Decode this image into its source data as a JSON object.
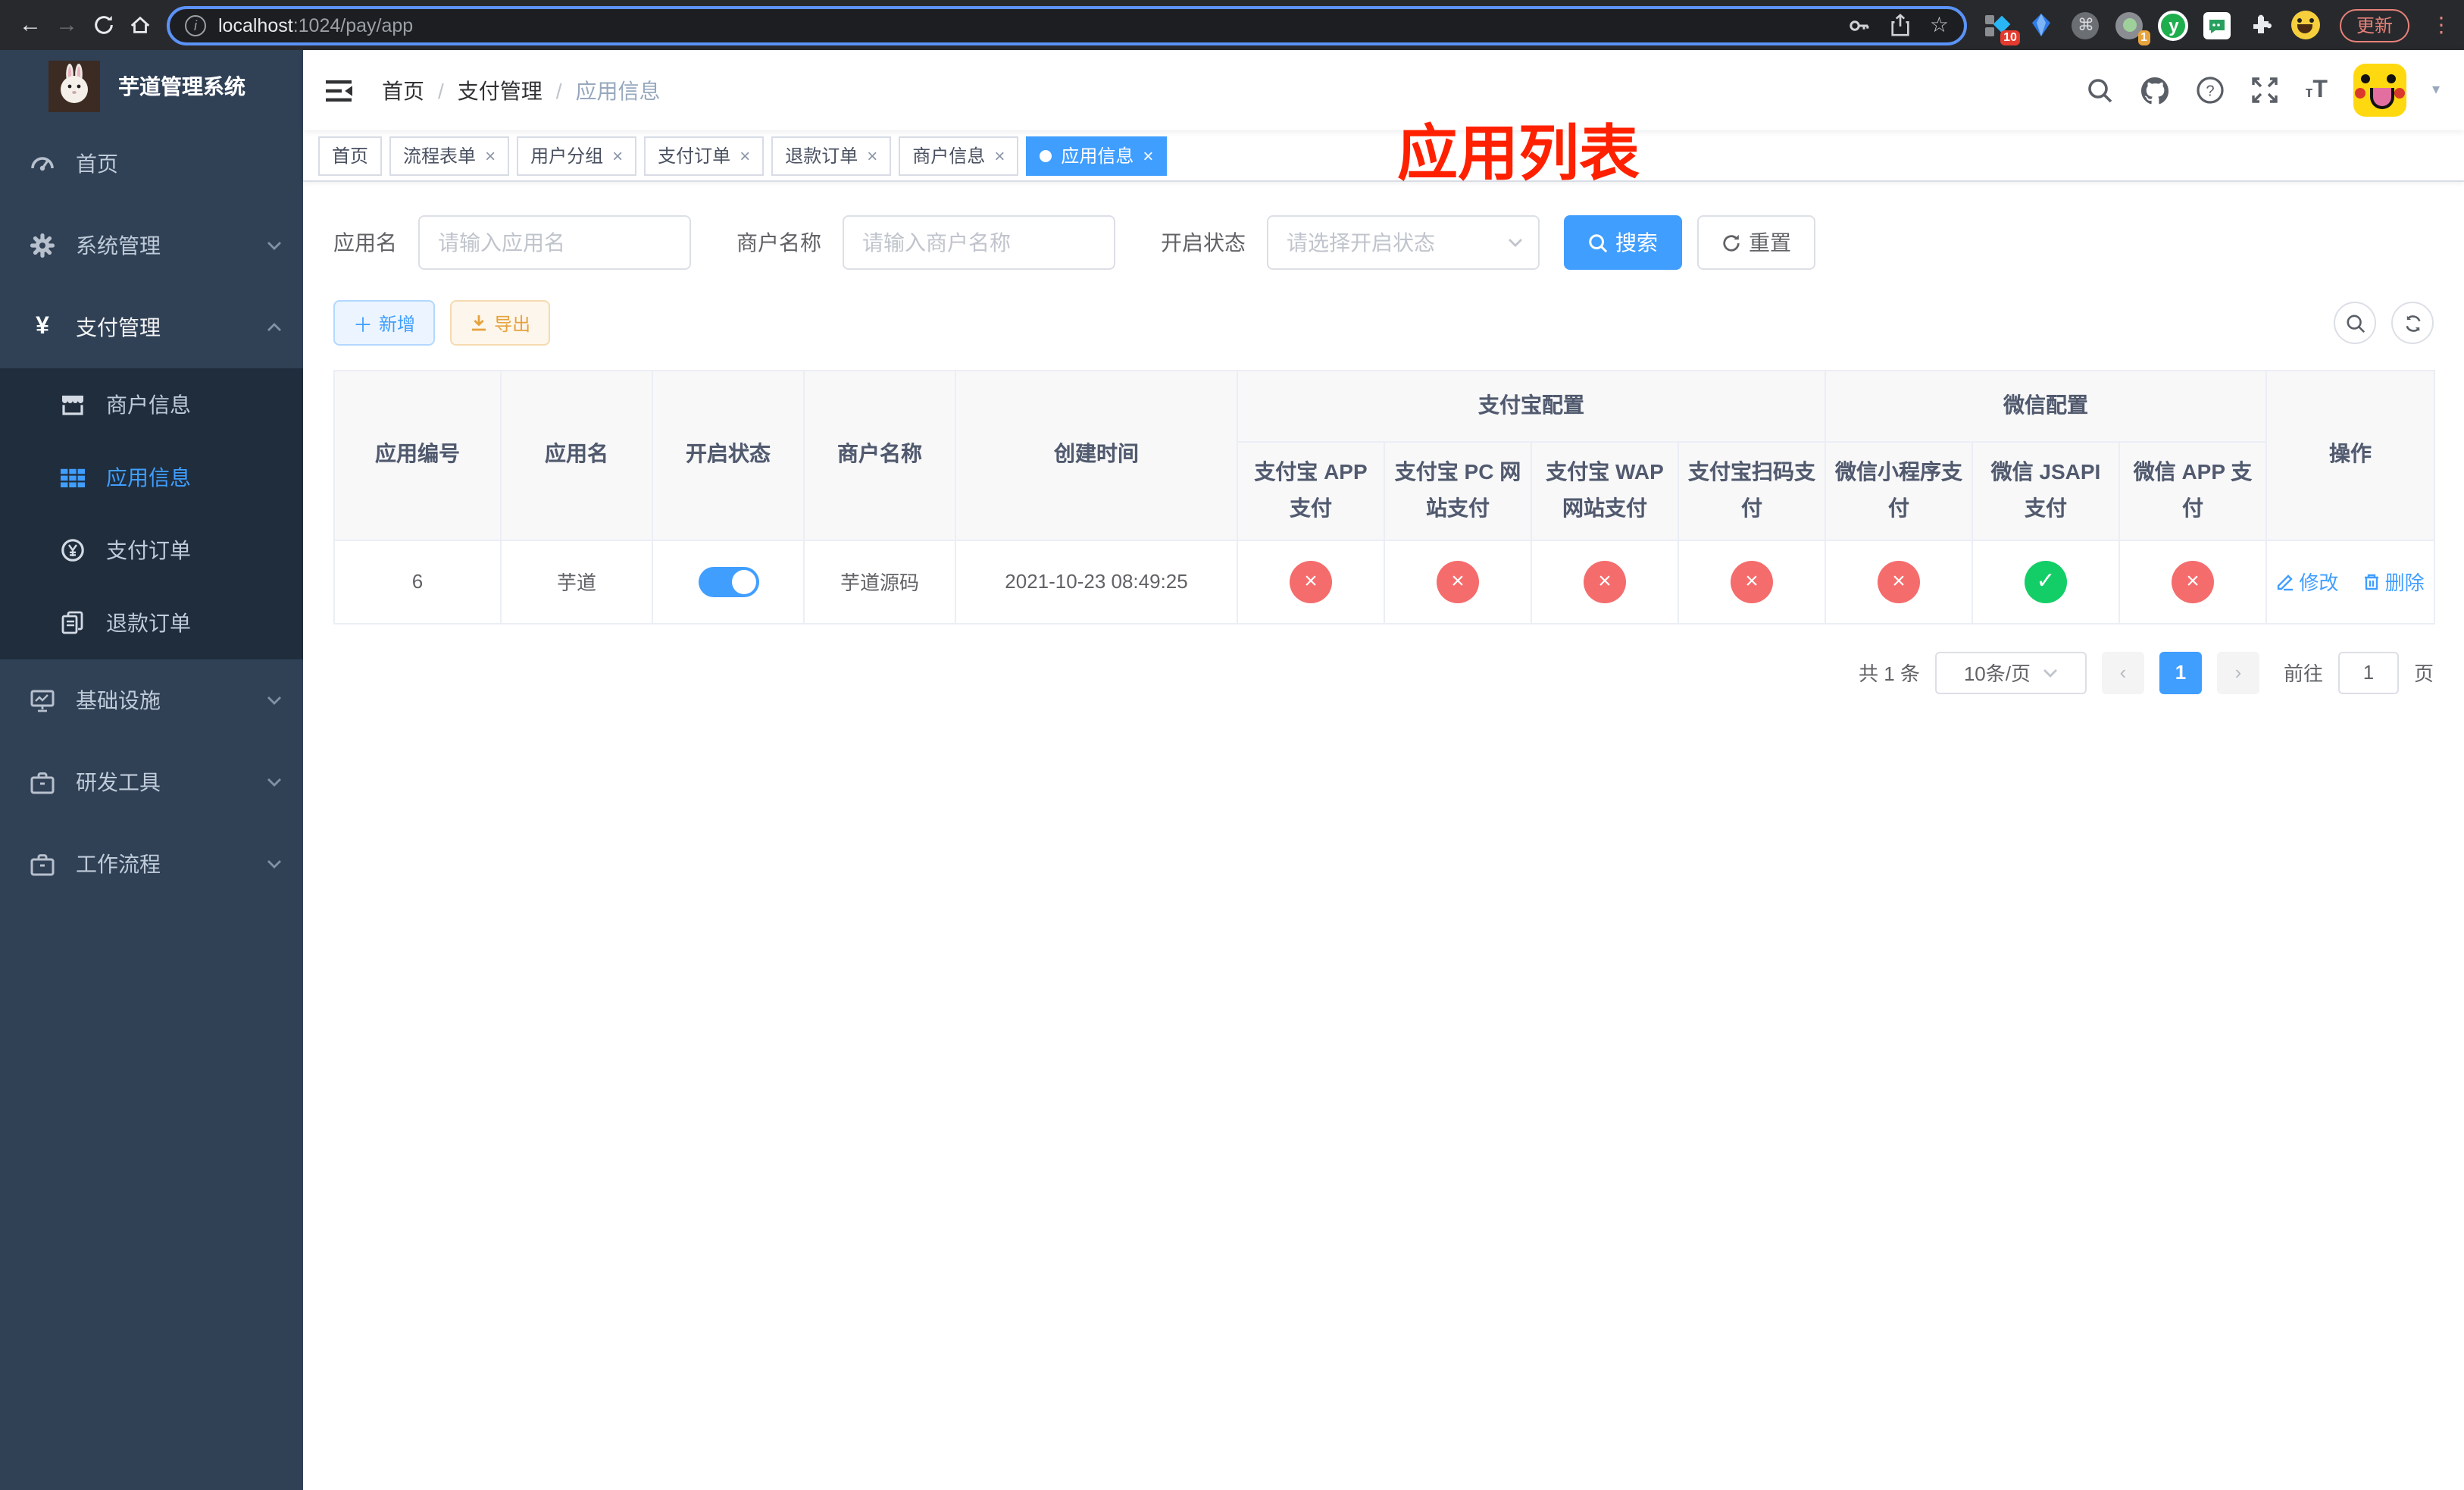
{
  "browser": {
    "url_host": "localhost",
    "url_rest": ":1024/pay/app",
    "update_label": "更新",
    "ext_badge_blocks": "10",
    "ext_badge_tray": "1",
    "ext_y_letter": "y"
  },
  "sidebar": {
    "title": "芋道管理系统",
    "items": [
      {
        "label": "首页",
        "icon": "dashboard-icon"
      },
      {
        "label": "系统管理",
        "icon": "gear-icon",
        "expandable": true
      },
      {
        "label": "支付管理",
        "icon": "yen-icon",
        "expandable": true,
        "expanded": true
      },
      {
        "label": "商户信息",
        "icon": "store-icon",
        "submenu": true
      },
      {
        "label": "应用信息",
        "icon": "grid-icon",
        "submenu": true,
        "active": true
      },
      {
        "label": "支付订单",
        "icon": "pay-order-icon",
        "submenu": true
      },
      {
        "label": "退款订单",
        "icon": "refund-icon",
        "submenu": true
      },
      {
        "label": "基础设施",
        "icon": "monitor-icon",
        "expandable": true
      },
      {
        "label": "研发工具",
        "icon": "toolbox-icon",
        "expandable": true
      },
      {
        "label": "工作流程",
        "icon": "toolbox-icon",
        "expandable": true
      }
    ]
  },
  "navbar": {
    "breadcrumb": [
      {
        "label": "首页"
      },
      {
        "label": "支付管理"
      },
      {
        "label": "应用信息"
      }
    ]
  },
  "overlay_title": "应用列表",
  "tabs": [
    {
      "label": "首页",
      "closable": false,
      "active": false
    },
    {
      "label": "流程表单",
      "closable": true,
      "active": false
    },
    {
      "label": "用户分组",
      "closable": true,
      "active": false
    },
    {
      "label": "支付订单",
      "closable": true,
      "active": false
    },
    {
      "label": "退款订单",
      "closable": true,
      "active": false
    },
    {
      "label": "商户信息",
      "closable": true,
      "active": false
    },
    {
      "label": "应用信息",
      "closable": true,
      "active": true
    }
  ],
  "filter": {
    "app_name_label": "应用名",
    "app_name_placeholder": "请输入应用名",
    "merchant_label": "商户名称",
    "merchant_placeholder": "请输入商户名称",
    "status_label": "开启状态",
    "status_placeholder": "请选择开启状态",
    "search_label": "搜索",
    "reset_label": "重置"
  },
  "toolbar": {
    "add_label": "新增",
    "export_label": "导出"
  },
  "table": {
    "headers": {
      "app_id": "应用编号",
      "app_name": "应用名",
      "status": "开启状态",
      "merchant": "商户名称",
      "create_time": "创建时间",
      "alipay_group": "支付宝配置",
      "wechat_group": "微信配置",
      "actions": "操作",
      "alipay_app": "支付宝 APP 支付",
      "alipay_pc": "支付宝 PC 网站支付",
      "alipay_wap": "支付宝 WAP 网站支付",
      "alipay_qr": "支付宝扫码支付",
      "wx_mini": "微信小程序支付",
      "wx_jsapi": "微信 JSAPI 支付",
      "wx_app": "微信 APP 支付"
    },
    "row": {
      "app_id": "6",
      "app_name": "芋道",
      "status_on": true,
      "merchant": "芋道源码",
      "create_time": "2021-10-23 08:49:25",
      "channels": [
        false,
        false,
        false,
        false,
        false,
        true,
        false
      ],
      "edit_label": "修改",
      "delete_label": "删除"
    }
  },
  "pagination": {
    "total": "共 1 条",
    "page_size": "10条/页",
    "current_page": "1",
    "goto_label": "前往",
    "goto_value": "1",
    "page_unit": "页"
  },
  "colors": {
    "primary": "#409eff",
    "success": "#13ce66",
    "danger": "#f56c6c",
    "warning": "#e6a23c",
    "sidebar_bg": "#304156",
    "submenu_bg": "#1f2d3d",
    "overlay_red": "#ff2000"
  }
}
